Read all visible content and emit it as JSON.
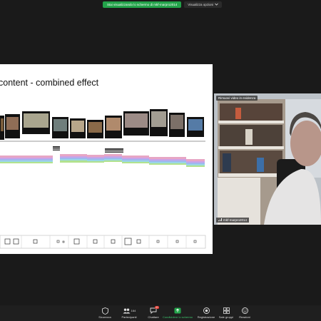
{
  "banner": {
    "sharing_text": "Stai visualizzando lo schermo di mkf-marpro2014",
    "view_options_label": "Visualizza opzioni",
    "view_options_chevron": "chevron-down-icon"
  },
  "slide": {
    "title": "content - combined effect"
  },
  "video": {
    "spotlight_label": "Rimuovi video in evidenza",
    "participant_name": "mkf-marpro2014"
  },
  "toolbar": {
    "items": [
      {
        "label": "Sicurezza",
        "icon": "shield-icon"
      },
      {
        "label": "Partecipanti",
        "icon": "participants-icon",
        "count": "164"
      },
      {
        "label": "Chattare",
        "icon": "chat-icon",
        "badge": "41"
      },
      {
        "label": "Condividere lo schermo",
        "icon": "share-screen-icon"
      },
      {
        "label": "Registrazione",
        "icon": "record-icon"
      },
      {
        "label": "Sale gruppi",
        "icon": "breakout-rooms-icon"
      },
      {
        "label": "Reazioni",
        "icon": "reactions-icon"
      }
    ]
  },
  "colors": {
    "share_green": "#23a34a",
    "accent_dot": "#d4a58c",
    "chat_badge": "#e0362c"
  }
}
